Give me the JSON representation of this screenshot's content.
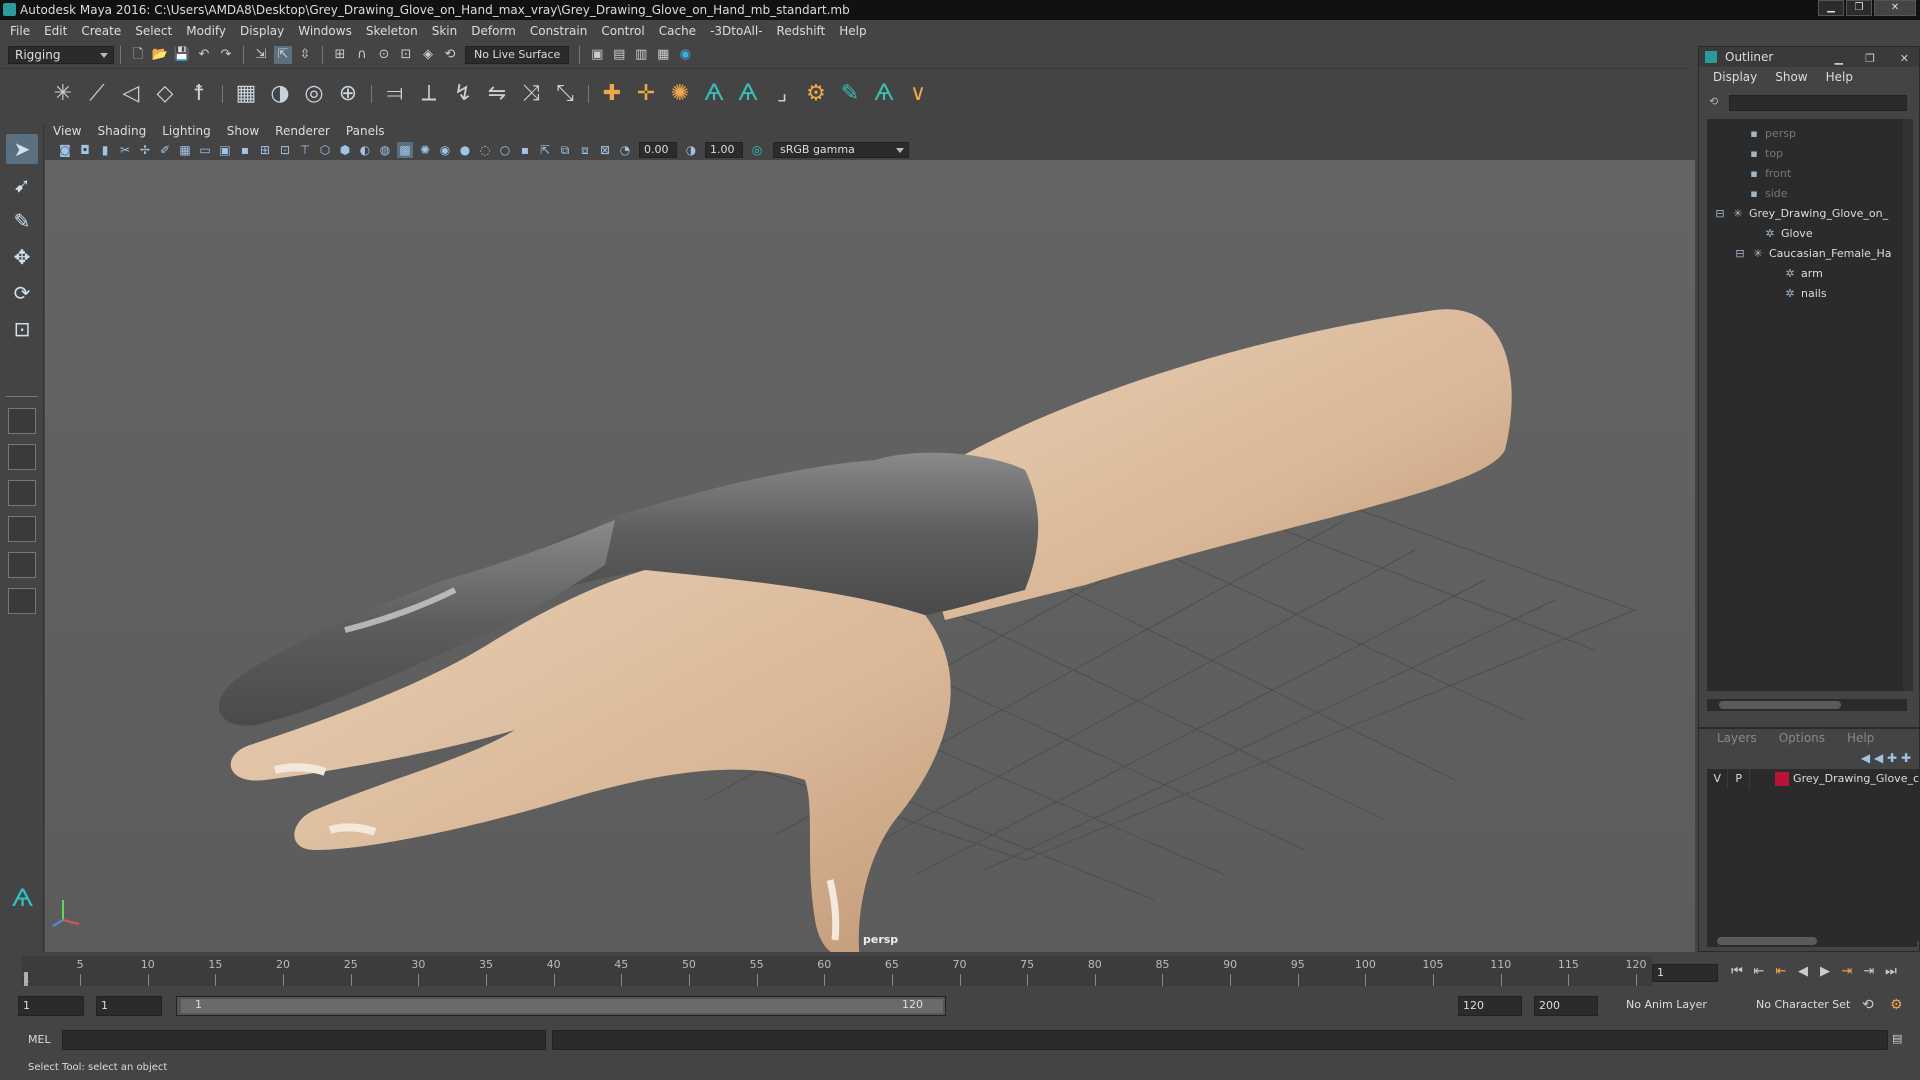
{
  "window": {
    "title": "Autodesk Maya 2016: C:\\Users\\AMDA8\\Desktop\\Grey_Drawing_Glove_on_Hand_max_vray\\Grey_Drawing_Glove_on_Hand_mb_standart.mb"
  },
  "menubar": [
    "File",
    "Edit",
    "Create",
    "Select",
    "Modify",
    "Display",
    "Windows",
    "Skeleton",
    "Skin",
    "Deform",
    "Constrain",
    "Control",
    "Cache",
    "-3DtoAll-",
    "Redshift",
    "Help"
  ],
  "toolbar": {
    "mode": "Rigging",
    "live_surface": "No Live Surface"
  },
  "viewport": {
    "menus": [
      "View",
      "Shading",
      "Lighting",
      "Show",
      "Renderer",
      "Panels"
    ],
    "exposure": "0.00",
    "gamma_value": "1.00",
    "color_space": "sRGB gamma",
    "camera_label": "persp"
  },
  "outliner": {
    "title": "Outliner",
    "menus": [
      "Display",
      "Show",
      "Help"
    ],
    "items": [
      {
        "label": "persp",
        "type": "camera"
      },
      {
        "label": "top",
        "type": "camera"
      },
      {
        "label": "front",
        "type": "camera"
      },
      {
        "label": "side",
        "type": "camera"
      },
      {
        "label": "Grey_Drawing_Glove_on_",
        "type": "group"
      },
      {
        "label": "Glove",
        "type": "mesh"
      },
      {
        "label": "Caucasian_Female_Ha",
        "type": "group"
      },
      {
        "label": "arm",
        "type": "mesh"
      },
      {
        "label": "nails",
        "type": "mesh"
      }
    ]
  },
  "layers": {
    "menus": [
      "Layers",
      "Options",
      "Help"
    ],
    "rows": [
      {
        "v": "V",
        "p": "P",
        "name": "Grey_Drawing_Glove_c",
        "color": "#b8143a"
      }
    ]
  },
  "timeline": {
    "ticks": [
      "5",
      "10",
      "15",
      "20",
      "25",
      "30",
      "35",
      "40",
      "45",
      "50",
      "55",
      "60",
      "65",
      "70",
      "75",
      "80",
      "85",
      "90",
      "95",
      "100",
      "105",
      "110",
      "115",
      "120"
    ],
    "start_label": "1",
    "current_frame": "1"
  },
  "range": {
    "start": "1",
    "playback_start": "1",
    "slider_start": "1",
    "slider_end": "120",
    "playback_end": "120",
    "end": "200",
    "anim_layer": "No Anim Layer",
    "character_set": "No Character Set"
  },
  "command_line": {
    "label": "MEL"
  },
  "help_line": {
    "text": "Select Tool: select an object"
  }
}
